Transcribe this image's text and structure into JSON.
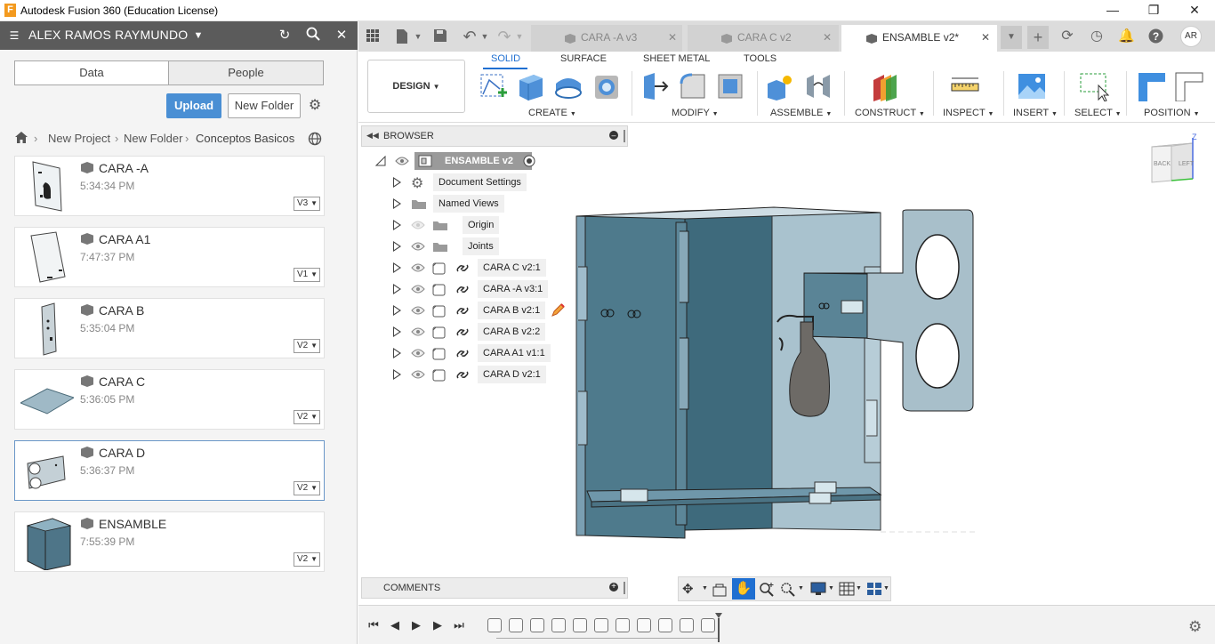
{
  "window": {
    "app_icon": "F",
    "title": "Autodesk Fusion 360 (Education License)",
    "controls": [
      "minimize-icon",
      "restore-icon",
      "close-icon"
    ]
  },
  "data_panel": {
    "user": "ALEX RAMOS RAYMUNDO",
    "tabs": [
      "Data",
      "People"
    ],
    "upload_label": "Upload",
    "new_folder_label": "New Folder",
    "breadcrumb": [
      "New Project",
      "New Folder",
      "Conceptos Basicos"
    ],
    "items": [
      {
        "name": "CARA -A",
        "time": "5:34:34 PM",
        "version": "V3"
      },
      {
        "name": "CARA A1",
        "time": "7:47:37 PM",
        "version": "V1"
      },
      {
        "name": "CARA B",
        "time": "5:35:04 PM",
        "version": "V2"
      },
      {
        "name": "CARA C",
        "time": "5:36:05 PM",
        "version": "V2"
      },
      {
        "name": "CARA D",
        "time": "5:36:37 PM",
        "version": "V2"
      },
      {
        "name": "ENSAMBLE",
        "time": "7:55:39 PM",
        "version": "V2"
      }
    ]
  },
  "doc_tabs": [
    {
      "label": "CARA -A v3",
      "active": false
    },
    {
      "label": "CARA C v2",
      "active": false
    },
    {
      "label": "ENSAMBLE v2*",
      "active": true
    }
  ],
  "user_initials": "AR",
  "toolbar": {
    "workspace": "DESIGN",
    "tabs": [
      "SOLID",
      "SURFACE",
      "SHEET METAL",
      "TOOLS"
    ],
    "active_tab": "SOLID",
    "groups": [
      "CREATE",
      "MODIFY",
      "ASSEMBLE",
      "CONSTRUCT",
      "INSPECT",
      "INSERT",
      "SELECT",
      "POSITION"
    ]
  },
  "browser": {
    "title": "BROWSER",
    "root": "ENSAMBLE v2",
    "nodes": [
      "Document Settings",
      "Named Views",
      "Origin",
      "Joints",
      "CARA C v2:1",
      "CARA -A v3:1",
      "CARA B v2:1",
      "CARA B v2:2",
      "CARA  A1 v1:1",
      "CARA D v2:1"
    ]
  },
  "comments_title": "COMMENTS",
  "viewcube": {
    "back": "BACK",
    "left": "LEFT",
    "axis": "Z"
  },
  "colors": {
    "accent": "#1f6fd1",
    "upload": "#4a8fd4",
    "userbar": "#5b5b5b",
    "model": "#5d8aa0"
  }
}
